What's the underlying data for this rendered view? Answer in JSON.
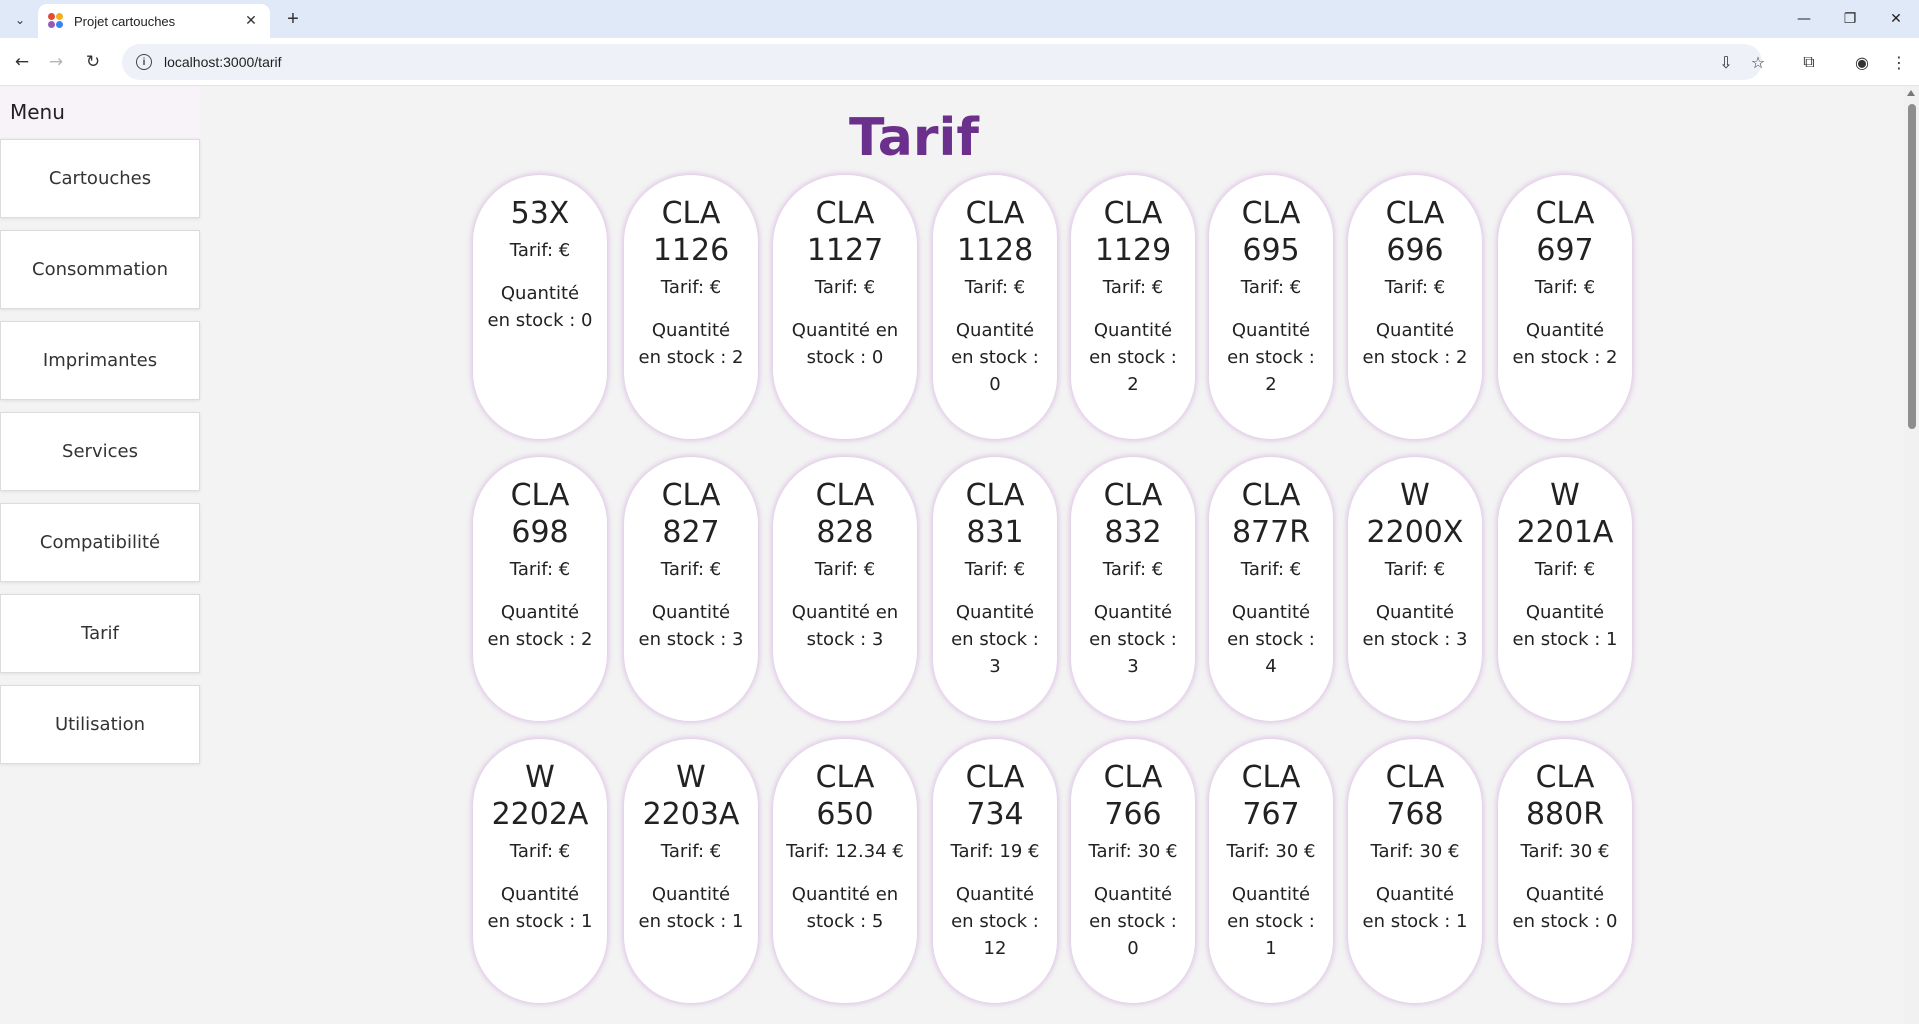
{
  "browser": {
    "tab_title": "Projet cartouches",
    "url": "localhost:3000/tarif"
  },
  "sidebar": {
    "title": "Menu",
    "items": [
      {
        "label": "Cartouches"
      },
      {
        "label": "Consommation"
      },
      {
        "label": "Imprimantes"
      },
      {
        "label": "Services"
      },
      {
        "label": "Compatibilité"
      },
      {
        "label": "Tarif"
      },
      {
        "label": "Utilisation"
      }
    ]
  },
  "main": {
    "title": "Tarif",
    "cards": [
      {
        "name": "53X",
        "price": "Tarif: €",
        "stock": "Quantité en stock : 0"
      },
      {
        "name": "CLA 1126",
        "price": "Tarif: €",
        "stock": "Quantité en stock : 2"
      },
      {
        "name": "CLA 1127",
        "price": "Tarif: €",
        "stock": "Quantité en stock : 0"
      },
      {
        "name": "CLA 1128",
        "price": "Tarif: €",
        "stock": "Quantité en stock : 0"
      },
      {
        "name": "CLA 1129",
        "price": "Tarif: €",
        "stock": "Quantité en stock : 2"
      },
      {
        "name": "CLA 695",
        "price": "Tarif: €",
        "stock": "Quantité en stock : 2"
      },
      {
        "name": "CLA 696",
        "price": "Tarif: €",
        "stock": "Quantité en stock : 2"
      },
      {
        "name": "CLA 697",
        "price": "Tarif: €",
        "stock": "Quantité en stock : 2"
      },
      {
        "name": "CLA 698",
        "price": "Tarif: €",
        "stock": "Quantité en stock : 2"
      },
      {
        "name": "CLA 827",
        "price": "Tarif: €",
        "stock": "Quantité en stock : 3"
      },
      {
        "name": "CLA 828",
        "price": "Tarif: €",
        "stock": "Quantité en stock : 3"
      },
      {
        "name": "CLA 831",
        "price": "Tarif: €",
        "stock": "Quantité en stock : 3"
      },
      {
        "name": "CLA 832",
        "price": "Tarif: €",
        "stock": "Quantité en stock : 3"
      },
      {
        "name": "CLA 877R",
        "price": "Tarif: €",
        "stock": "Quantité en stock : 4"
      },
      {
        "name": "W 2200X",
        "price": "Tarif: €",
        "stock": "Quantité en stock : 3"
      },
      {
        "name": "W 2201A",
        "price": "Tarif: €",
        "stock": "Quantité en stock : 1"
      },
      {
        "name": "W 2202A",
        "price": "Tarif: €",
        "stock": "Quantité en stock : 1"
      },
      {
        "name": "W 2203A",
        "price": "Tarif: €",
        "stock": "Quantité en stock : 1"
      },
      {
        "name": "CLA 650",
        "price": "Tarif: 12.34 €",
        "stock": "Quantité en stock : 5"
      },
      {
        "name": "CLA 734",
        "price": "Tarif: 19 €",
        "stock": "Quantité en stock : 12"
      },
      {
        "name": "CLA 766",
        "price": "Tarif: 30 €",
        "stock": "Quantité en stock : 0"
      },
      {
        "name": "CLA 767",
        "price": "Tarif: 30 €",
        "stock": "Quantité en stock : 1"
      },
      {
        "name": "CLA 768",
        "price": "Tarif: 30 €",
        "stock": "Quantité en stock : 1"
      },
      {
        "name": "CLA 880R",
        "price": "Tarif: 30 €",
        "stock": "Quantité en stock : 0"
      }
    ]
  }
}
